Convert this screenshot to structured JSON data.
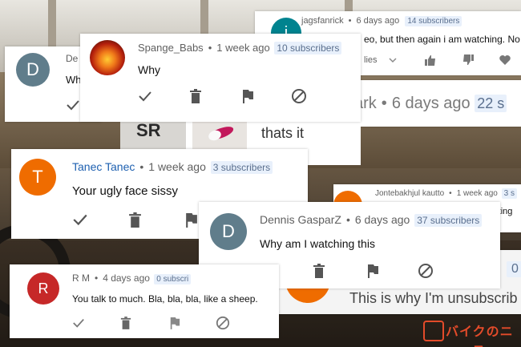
{
  "background": {
    "shirt_logo": "SR",
    "watermark": "バイクのニュース"
  },
  "colors": {
    "avatar_slate": "#607d8b",
    "avatar_orange": "#ef6c00",
    "avatar_red": "#c62828",
    "name_blue": "#1e60b0",
    "badge_bg": "#e8f0fb",
    "badge_text": "#5a6f8e",
    "meta_gray": "#606060",
    "icon_gray": "#8a8a8a"
  },
  "cards": {
    "jagsfanrick": {
      "avatar": "i",
      "name": "jagsfanrick",
      "time": "6 days ago",
      "badge": "14 subscribers",
      "text": "eo, but then again i am watching. No thum",
      "replies": "lies"
    },
    "ark": {
      "name": "ark",
      "time": "6 days ago",
      "badge": "22 s",
      "reply_text": "thats it"
    },
    "de": {
      "avatar": "D",
      "name": "De",
      "text": "Wh"
    },
    "spange": {
      "name": "Spange_Babs",
      "time": "1 week ago",
      "badge": "10 subscribers",
      "text": "Why"
    },
    "tanec": {
      "avatar": "T",
      "name": "Tanec Tanec",
      "time": "1 week ago",
      "badge": "3 subscribers",
      "text": "Your ugly face sissy"
    },
    "jonte": {
      "name": "Jontebakhjul kautto",
      "time": "1 week ago",
      "badge": "3 s",
      "text": "rting"
    },
    "dennis": {
      "avatar": "D",
      "name": "Dennis GasparZ",
      "time": "6 days ago",
      "badge": "37 subscribers",
      "text": "Why am I watching this"
    },
    "unsub": {
      "text": "This is why I'm unsubscrib",
      "badge": "0"
    },
    "rm": {
      "avatar": "R",
      "name": "R M",
      "time": "4 days ago",
      "badge": "0 subscri",
      "text": "You talk to much. Bla, bla, bla, like a sheep."
    }
  }
}
